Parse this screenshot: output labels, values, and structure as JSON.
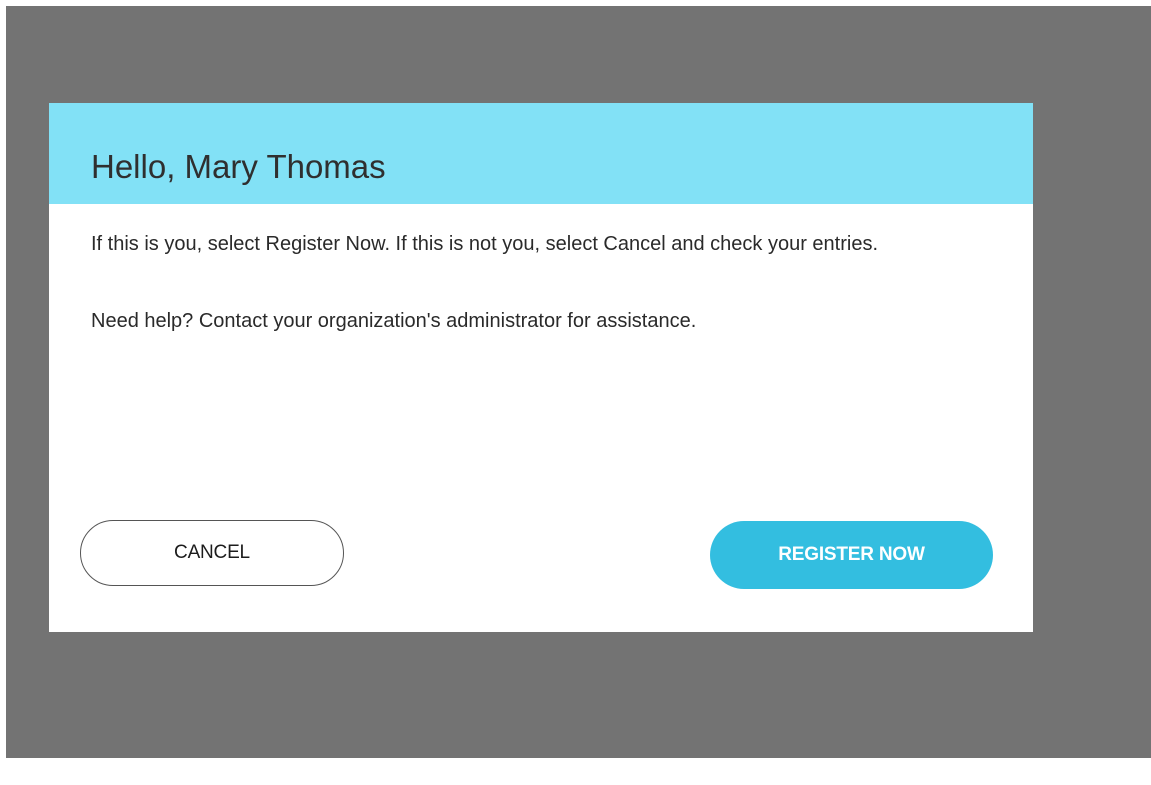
{
  "dialog": {
    "title": "Hello, Mary Thomas",
    "paragraph_1": "If this is you, select Register Now. If this is not you, select Cancel and check your entries.",
    "paragraph_2": "Need help? Contact your organization's administrator for assistance.",
    "cancel_label": "CANCEL",
    "register_label": "REGISTER NOW"
  },
  "colors": {
    "overlay": "#737373",
    "header": "#82e1f6",
    "primary_button": "#33bee0"
  }
}
